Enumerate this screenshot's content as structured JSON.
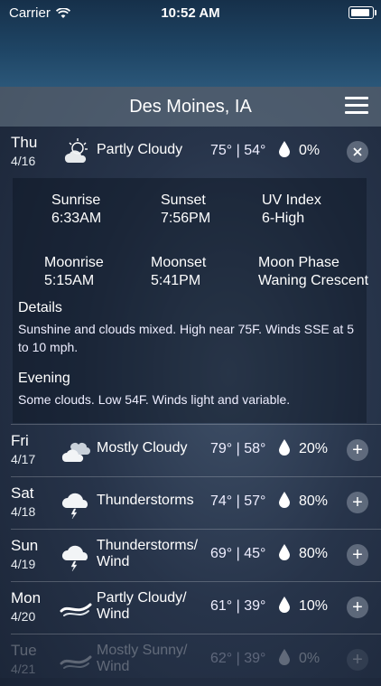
{
  "status_bar": {
    "carrier": "Carrier",
    "time": "10:52 AM",
    "battery_level": 0.9
  },
  "header": {
    "title": "Des Moines, IA"
  },
  "forecast": [
    {
      "day": "Thu",
      "date": "4/16",
      "icon": "partly-cloudy-sun-icon",
      "condition": "Partly Cloudy",
      "temps": "75° | 54°",
      "precip": "0%",
      "button": "close"
    },
    {
      "day": "Fri",
      "date": "4/17",
      "icon": "mostly-cloudy-icon",
      "condition": "Mostly Cloudy",
      "temps": "79° | 58°",
      "precip": "20%",
      "button": "expand"
    },
    {
      "day": "Sat",
      "date": "4/18",
      "icon": "thunderstorm-icon",
      "condition": "Thunderstorms",
      "temps": "74° | 57°",
      "precip": "80%",
      "button": "expand"
    },
    {
      "day": "Sun",
      "date": "4/19",
      "icon": "thunderstorm-icon",
      "condition": "Thunderstorms/ Wind",
      "temps": "69° | 45°",
      "precip": "80%",
      "button": "expand"
    },
    {
      "day": "Mon",
      "date": "4/20",
      "icon": "wind-icon",
      "condition": "Partly Cloudy/ Wind",
      "temps": "61° | 39°",
      "precip": "10%",
      "button": "expand"
    },
    {
      "day": "Tue",
      "date": "4/21",
      "icon": "wind-icon",
      "condition": "Mostly Sunny/ Wind",
      "temps": "62° | 39°",
      "precip": "0%",
      "button": "expand"
    }
  ],
  "details": {
    "sunrise_label": "Sunrise",
    "sunrise": "6:33AM",
    "sunset_label": "Sunset",
    "sunset": "7:56PM",
    "uv_label": "UV Index",
    "uv": "6-High",
    "moonrise_label": "Moonrise",
    "moonrise": "5:15AM",
    "moonset_label": "Moonset",
    "moonset": "5:41PM",
    "moonphase_label": "Moon Phase",
    "moonphase": "Waning Crescent",
    "details_title": "Details",
    "details_text": "Sunshine and clouds mixed. High near 75F. Winds SSE at 5 to 10 mph.",
    "evening_title": "Evening",
    "evening_text": "Some clouds. Low 54F. Winds light and variable."
  }
}
